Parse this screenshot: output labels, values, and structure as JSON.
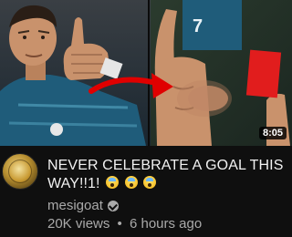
{
  "video": {
    "duration": "8:05",
    "title": "NEVER CELEBRATE A GOAL THIS WAY!!1!",
    "title_emoji": [
      "scream-emoji",
      "scream-emoji",
      "scream-emoji"
    ],
    "channel": "mesigoat",
    "channel_verified_icon": "verified-check-icon",
    "views": "20K views",
    "separator": "•",
    "uploaded": "6 hours ago"
  },
  "thumbnail": {
    "left_jersey_number": "7",
    "colors": {
      "jersey": "#1f5c7a",
      "skin": "#c9926c",
      "red_card": "#e11d1d",
      "arrow": "#e00000",
      "background": "#1b2a3a"
    }
  }
}
